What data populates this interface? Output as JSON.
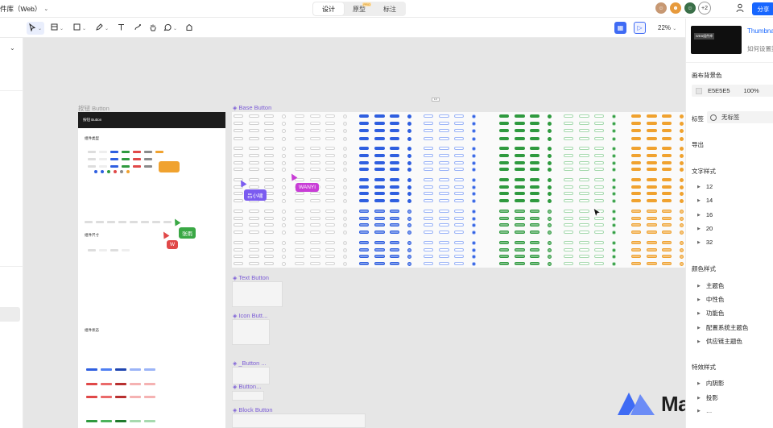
{
  "header": {
    "title": "件库（Web）",
    "tabs": [
      {
        "label": "设计",
        "active": true
      },
      {
        "label": "原型",
        "active": false,
        "badge": "PRO"
      },
      {
        "label": "标注",
        "active": false
      }
    ],
    "extra_collaborators": "+2",
    "share_label": "分享"
  },
  "toolbar": {
    "zoom": "22%"
  },
  "canvas": {
    "anchor_badge": "1/1",
    "frames": {
      "doc_frame_label": "按钮 Button",
      "doc_frame_header": "按钮 Button",
      "base_button": "Base Button",
      "text_button": "Text Button",
      "icon_button": "Icon Butt...",
      "button_group1": "_Button ...",
      "button_group2": "Button...",
      "block_button": "Block Button"
    },
    "doc_sections": {
      "s1": "组件类型",
      "s2": "组件尺寸",
      "s3": "组件状态"
    },
    "collaborators": [
      {
        "name": "吕小啸",
        "color": "#7b5cf0"
      },
      {
        "name": "WANYI",
        "color": "#c83cd6"
      },
      {
        "name": "张雨",
        "color": "#3aa845"
      },
      {
        "name": "W",
        "color": "#e04848"
      }
    ]
  },
  "right_panel": {
    "thumbnail_title": "Thumbnail",
    "thumbnail_text": "WEB组件库",
    "thumbnail_sub": "如何设置封面",
    "canvas_bg_heading": "画布背景色",
    "canvas_bg_hex": "E5E5E5",
    "canvas_bg_opacity": "100%",
    "tag_heading": "标签",
    "tag_value": "无标签",
    "export_heading": "导出",
    "text_styles_heading": "文字样式",
    "text_styles": [
      "12",
      "14",
      "16",
      "20",
      "32"
    ],
    "color_styles_heading": "颜色样式",
    "color_styles": [
      "主题色",
      "中性色",
      "功能色",
      "配置系统主题色",
      "供应链主题色"
    ],
    "effect_styles_heading": "特效样式",
    "effect_styles": [
      "内阴影",
      "投影",
      "…"
    ]
  },
  "watermark": "MasterGo",
  "colors": {
    "accent": "#1766ff",
    "canvas_bg": "#E5E5E5",
    "purple": "#7b5cd6",
    "blue_btn": "#2f5fe0",
    "green_btn": "#2f9a3f",
    "orange_btn": "#f0a22f"
  }
}
